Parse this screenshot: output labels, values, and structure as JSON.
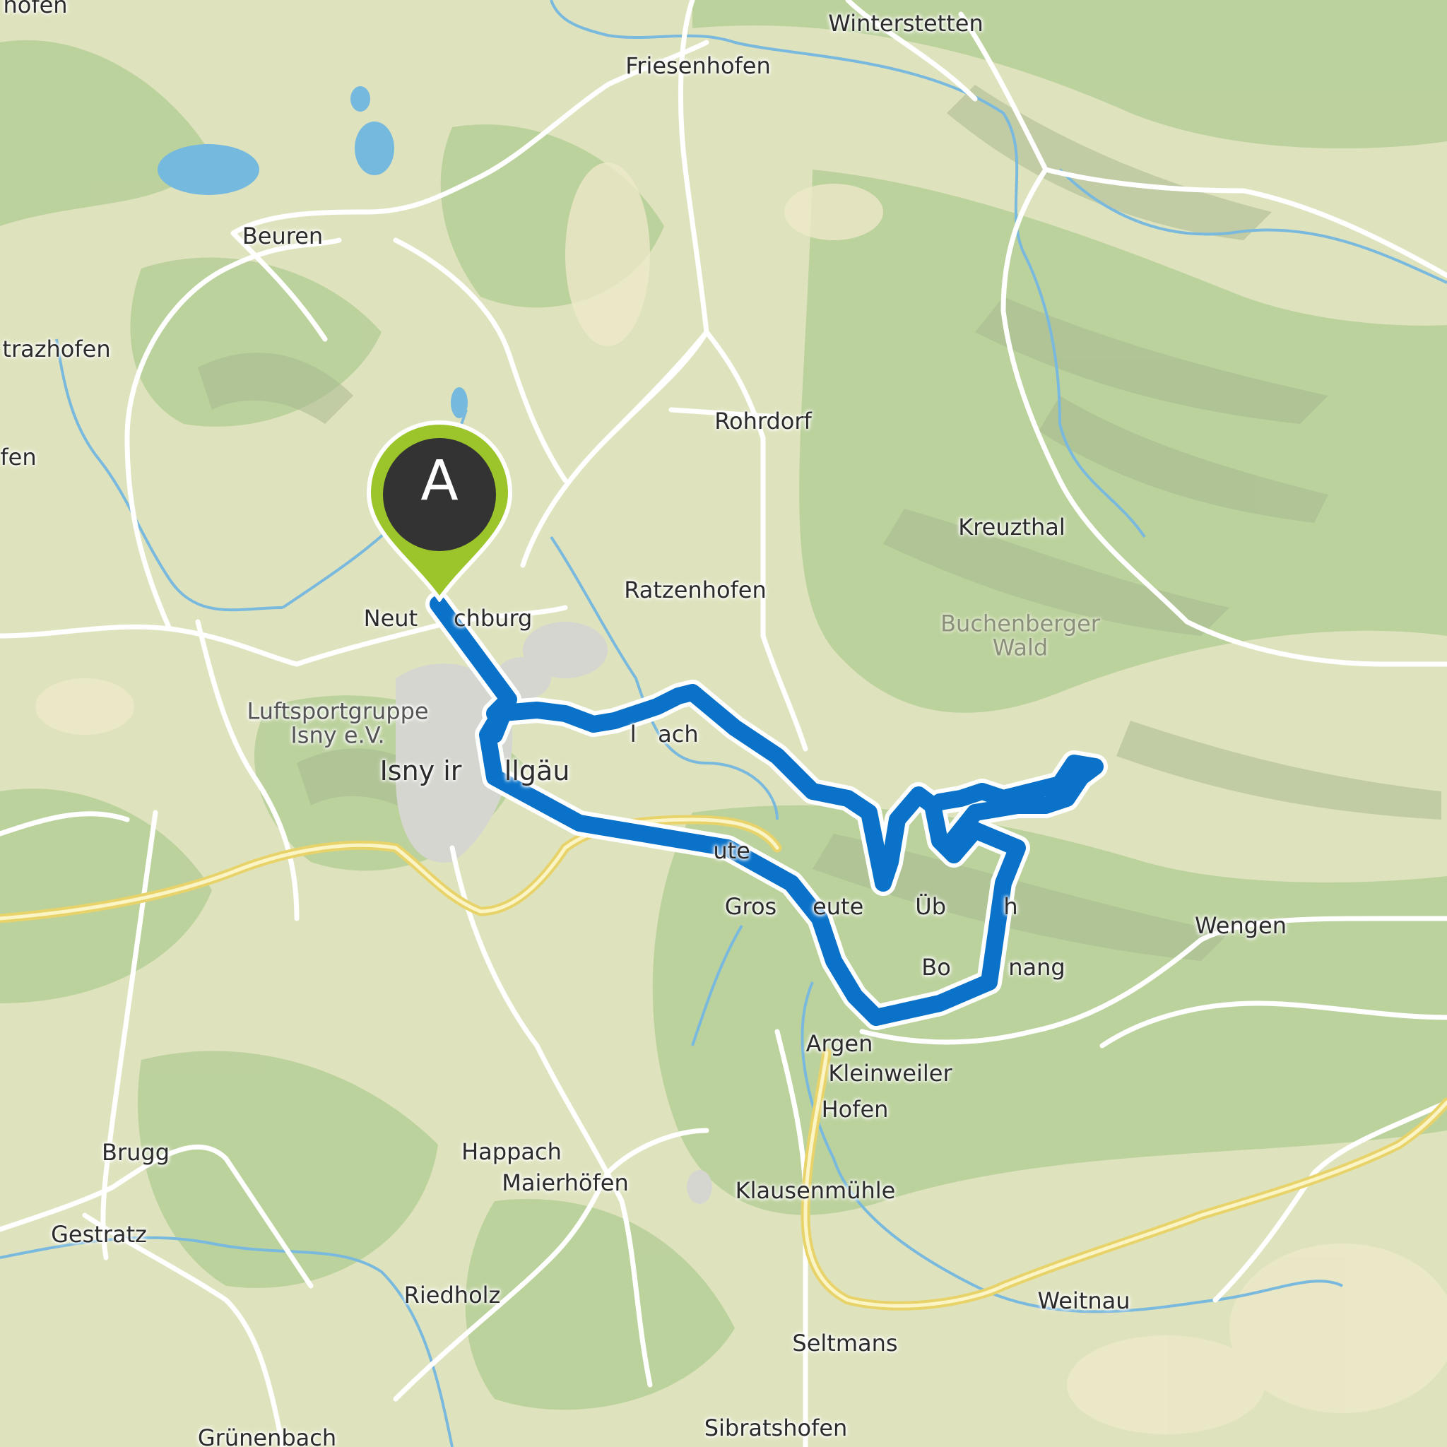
{
  "map": {
    "route_color": "#0a72c9",
    "marker_color": "#9bc52a",
    "marker_inner_color": "#333333",
    "terrain_base_color": "#d9dfb7",
    "forest_color": "#a9c890",
    "water_color": "#76b9df",
    "major_road_color": "#f1df7e"
  },
  "marker": {
    "label": "A"
  },
  "places": [
    {
      "id": "winterstetten",
      "label": "Winterstetten"
    },
    {
      "id": "friesenhofen",
      "label": "Friesenhofen"
    },
    {
      "id": "beuren",
      "label": "Beuren"
    },
    {
      "id": "strazhofen",
      "label": "trazhofen"
    },
    {
      "id": "fen",
      "label": "fen"
    },
    {
      "id": "rohrdorf",
      "label": "Rohrdorf"
    },
    {
      "id": "kreuzthal",
      "label": "Kreuzthal"
    },
    {
      "id": "ratzenhofen",
      "label": "Ratzenhofen"
    },
    {
      "id": "neutrauchburg",
      "label": "Neut     chburg"
    },
    {
      "id": "luftsport",
      "label": "Luftsportgruppe\nIsny e.V."
    },
    {
      "id": "isny",
      "label": "Isny ir     llgäu"
    },
    {
      "id": "buchenberger",
      "label": "Buchenberger\nWald"
    },
    {
      "id": "bach",
      "label": "  l   ach"
    },
    {
      "id": "neute",
      "label": "       ute"
    },
    {
      "id": "grossholzleute",
      "label": "Gros     eute"
    },
    {
      "id": "ueberruh",
      "label": "Üb        h"
    },
    {
      "id": "wengen",
      "label": "Wengen"
    },
    {
      "id": "bolsterlang",
      "label": "Bo        nang"
    },
    {
      "id": "argen",
      "label": "Argen"
    },
    {
      "id": "kleinweiler",
      "label": "Kleinweiler"
    },
    {
      "id": "hofen",
      "label": "Hofen"
    },
    {
      "id": "brugg",
      "label": "Brugg"
    },
    {
      "id": "happach",
      "label": "Happach"
    },
    {
      "id": "maierhoefen",
      "label": "Maierhöfen"
    },
    {
      "id": "klausenmuehle",
      "label": "Klausenmühle"
    },
    {
      "id": "gestratz",
      "label": "Gestratz"
    },
    {
      "id": "riedholz",
      "label": "Riedholz"
    },
    {
      "id": "weitnau",
      "label": "Weitnau"
    },
    {
      "id": "seltmans",
      "label": "Seltmans"
    },
    {
      "id": "sibratshofen",
      "label": "Sibratshofen"
    },
    {
      "id": "gruenenbach",
      "label": "Grünenbach"
    },
    {
      "id": "hofen_top",
      "label": "hofen"
    }
  ]
}
